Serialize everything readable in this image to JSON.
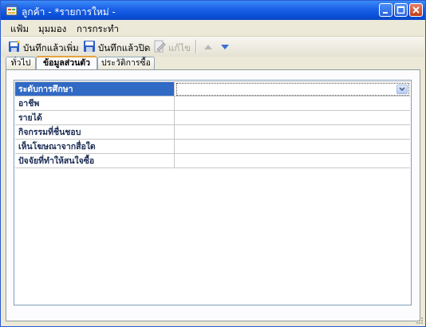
{
  "window": {
    "title": "ลูกค้า - *รายการใหม่ -"
  },
  "menu": [
    {
      "label": "แฟ้ม"
    },
    {
      "label": "มุมมอง"
    },
    {
      "label": "การกระทำ"
    }
  ],
  "toolbar": {
    "save_new_label": "บันทึกแล้วเพิ่ม",
    "save_close_label": "บันทึกแล้วปิด",
    "edit_label": "แก้ไข"
  },
  "tabs": [
    {
      "label": "ทั่วไป"
    },
    {
      "label": "ข้อมูลส่วนตัว"
    },
    {
      "label": "ประวัติการซื้อ"
    }
  ],
  "properties": [
    {
      "name": "ระดับการศึกษา",
      "value": ""
    },
    {
      "name": "อาชีพ",
      "value": ""
    },
    {
      "name": "รายได้",
      "value": ""
    },
    {
      "name": "กิจกรรมที่ชื่นชอบ",
      "value": ""
    },
    {
      "name": "เห็นโฆษณาจากสื่อใด",
      "value": ""
    },
    {
      "name": "ปัจจัยที่ทำให้สนใจซื้อ",
      "value": ""
    }
  ],
  "colors": {
    "titlebar": "#0a4fd8",
    "selection": "#316ac5",
    "active_tab_accent": "#e6a33c"
  }
}
